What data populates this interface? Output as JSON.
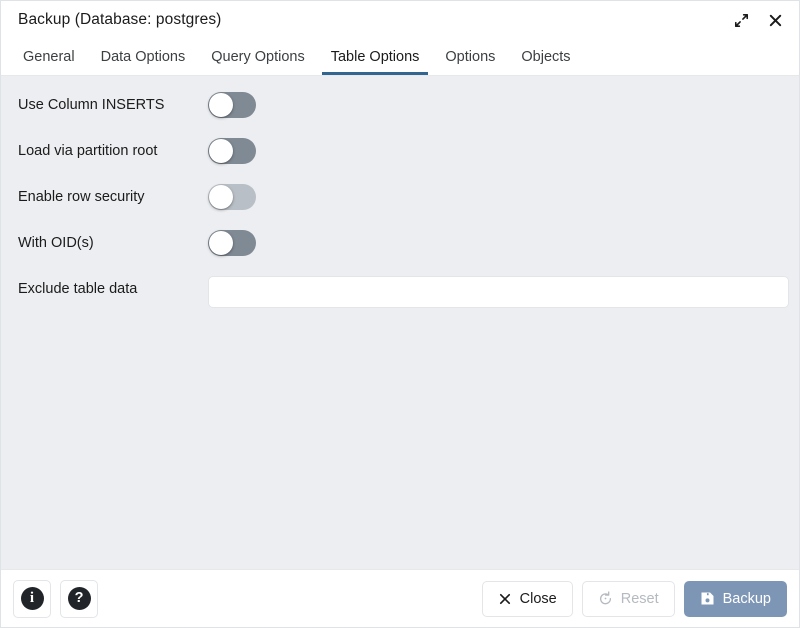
{
  "window": {
    "title": "Backup (Database: postgres)",
    "expand_icon": "expand-diagonal-icon",
    "close_icon": "close-icon"
  },
  "tabs": [
    {
      "label": "General",
      "active": false
    },
    {
      "label": "Data Options",
      "active": false
    },
    {
      "label": "Query Options",
      "active": false
    },
    {
      "label": "Table Options",
      "active": true
    },
    {
      "label": "Options",
      "active": false
    },
    {
      "label": "Objects",
      "active": false
    }
  ],
  "form": {
    "fields": [
      {
        "label": "Use Column INSERTS",
        "type": "toggle",
        "value": "off",
        "disabled": false
      },
      {
        "label": "Load via partition root",
        "type": "toggle",
        "value": "off",
        "disabled": false
      },
      {
        "label": "Enable row security",
        "type": "toggle",
        "value": "off",
        "disabled": true
      },
      {
        "label": "With OID(s)",
        "type": "toggle",
        "value": "off",
        "disabled": false
      },
      {
        "label": "Exclude table data",
        "type": "text",
        "value": "",
        "placeholder": ""
      }
    ]
  },
  "footer": {
    "info_label": "i",
    "help_label": "?",
    "close_label": "Close",
    "reset_label": "Reset",
    "backup_label": "Backup"
  },
  "colors": {
    "accent": "#326690",
    "content_background": "#eceef1",
    "primary_button": "#7e96b6",
    "toggle_off": "#808a94",
    "toggle_disabled": "#b8bfc6"
  }
}
